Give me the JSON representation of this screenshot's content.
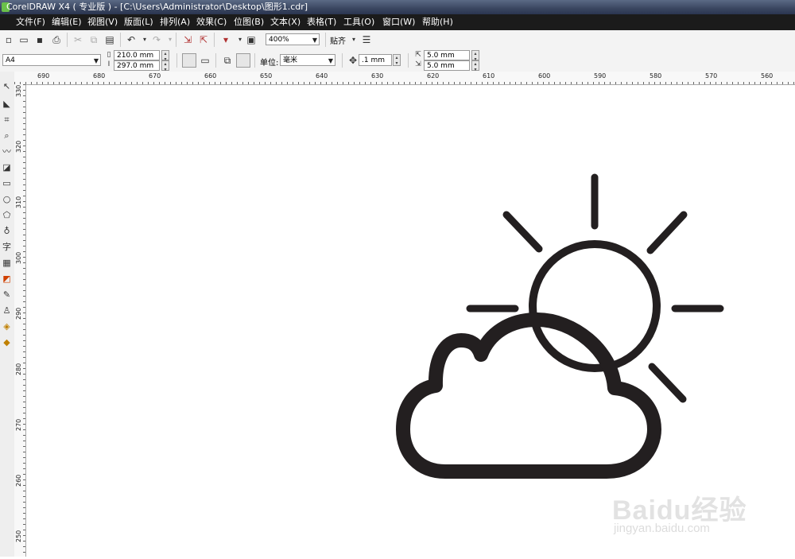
{
  "window": {
    "title": "CorelDRAW X4 ( 专业版 ) - [C:\\Users\\Administrator\\Desktop\\图形1.cdr]"
  },
  "menu": [
    "文件(F)",
    "编辑(E)",
    "视图(V)",
    "版面(L)",
    "排列(A)",
    "效果(C)",
    "位图(B)",
    "文本(X)",
    "表格(T)",
    "工具(O)",
    "窗口(W)",
    "帮助(H)"
  ],
  "toolbar": {
    "zoom": "400%",
    "snap_label": "贴齐"
  },
  "property_bar": {
    "page_size": "A4",
    "width": "210.0 mm",
    "height": "297.0 mm",
    "unit_label": "单位:",
    "unit": "毫米",
    "nudge": ".1 mm",
    "dup_x": "5.0 mm",
    "dup_y": "5.0 mm"
  },
  "rulers": {
    "horizontal": [
      "690",
      "680",
      "670",
      "660",
      "650",
      "640",
      "630",
      "620",
      "610",
      "600",
      "590",
      "580",
      "570",
      "560"
    ],
    "vertical": [
      "330",
      "320",
      "310",
      "300",
      "290",
      "280",
      "270",
      "260",
      "250"
    ]
  },
  "toolbox": {
    "text_tool_label": "字"
  },
  "watermark": {
    "brand": "Baidu经验",
    "sub": "jingyan.baidu.com"
  },
  "colors": {
    "stroke": "#231f20",
    "menubar": "#1b1b1b"
  }
}
